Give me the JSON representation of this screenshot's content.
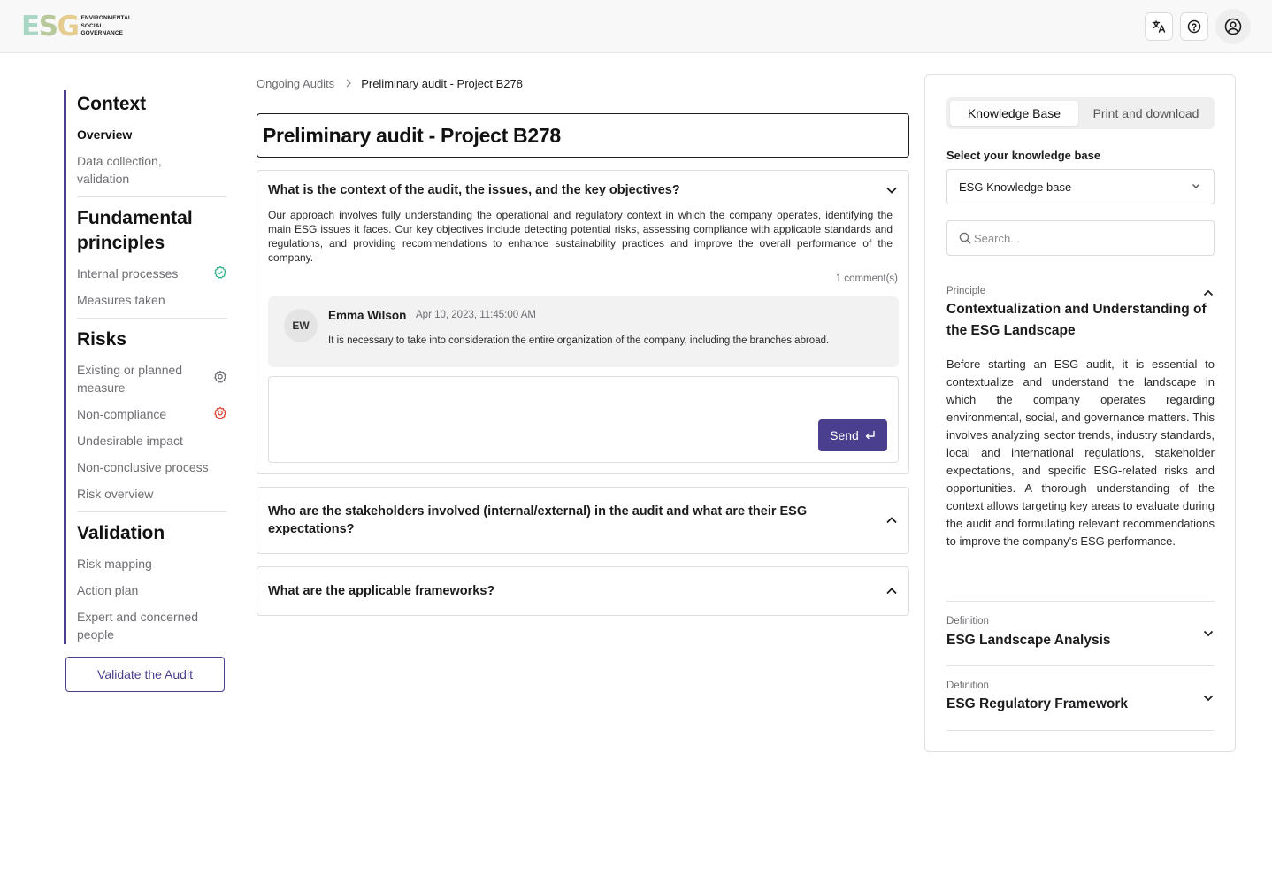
{
  "header": {
    "logo_letters": [
      "E",
      "S",
      "G"
    ],
    "logo_lines": [
      "ENVIRONMENTAL",
      "SOCIAL",
      "GOVERNANCE"
    ],
    "icons": [
      "translate-icon",
      "help-icon",
      "account-icon"
    ]
  },
  "sidebar": {
    "sections": [
      {
        "heading": "Context",
        "items": [
          {
            "label": "Overview",
            "active": true
          },
          {
            "label": "Data collection, validation"
          }
        ]
      },
      {
        "heading": "Fundamental principles",
        "items": [
          {
            "label": "Internal processes",
            "icon": "gear-check-icon",
            "icon_color": "#34b38a"
          },
          {
            "label": "Measures taken"
          }
        ]
      },
      {
        "heading": "Risks",
        "items": [
          {
            "label": "Existing or planned measure",
            "icon": "gear-icon",
            "icon_color": "#6e6e73"
          },
          {
            "label": "Non-compliance",
            "icon": "gear-alert-icon",
            "icon_color": "#e0453a"
          },
          {
            "label": "Undesirable impact"
          },
          {
            "label": "Non-conclusive process"
          },
          {
            "label": "Risk overview"
          }
        ]
      },
      {
        "heading": "Validation",
        "items": [
          {
            "label": "Risk mapping"
          },
          {
            "label": "Action plan"
          },
          {
            "label": "Expert and concerned people"
          }
        ]
      }
    ],
    "validate_label": "Validate the Audit"
  },
  "main": {
    "breadcrumb": {
      "parent": "Ongoing Audits",
      "current": "Preliminary audit - Project B278"
    },
    "title": "Preliminary audit - Project B278",
    "questions": [
      {
        "question": "What is the context of the audit, the issues, and the key objectives?",
        "expanded": true,
        "answer": "Our approach involves fully understanding the operational and regulatory context in which the company operates, identifying the main ESG issues it faces. Our key objectives include detecting potential risks, assessing compliance with applicable standards and regulations, and providing recommendations to enhance sustainability practices and improve the overall performance of the company.",
        "comment_count": "1 comment(s)",
        "comment": {
          "initials": "EW",
          "author": "Emma Wilson",
          "date": "Apr 10, 2023, 11:45:00 AM",
          "text": "It is necessary to take into consideration the entire organization of the company, including the branches abroad."
        },
        "reply_value": "",
        "send_label": "Send"
      },
      {
        "question": "Who are the stakeholders involved (internal/external) in the audit and what are their ESG expectations?",
        "expanded": false
      },
      {
        "question": "What are the applicable frameworks?",
        "expanded": false
      }
    ]
  },
  "knowledge_panel": {
    "tabs": [
      {
        "label": "Knowledge Base",
        "active": true
      },
      {
        "label": "Print and download",
        "active": false
      }
    ],
    "select_label": "Select your knowledge base",
    "selected_kb": "ESG Knowledge base",
    "search_placeholder": "Search...",
    "entries": [
      {
        "kind": "Principle",
        "title": "Contextualization and Understanding of the ESG Landscape",
        "expanded": true,
        "body": "Before starting an ESG audit, it is essential to contextualize and understand the landscape in which the company operates regarding environmental, social, and governance matters. This involves analyzing sector trends, industry standards, local and international regulations, stakeholder expectations, and specific ESG-related risks and opportunities. A thorough understanding of the context allows targeting key areas to evaluate during the audit and formulating relevant recommendations to improve the company's ESG performance."
      },
      {
        "kind": "Definition",
        "title": "ESG Landscape Analysis",
        "expanded": false
      },
      {
        "kind": "Definition",
        "title": "ESG Regulatory Framework",
        "expanded": false
      }
    ]
  },
  "colors": {
    "accent": "#4a3f8e",
    "ok": "#34b38a",
    "alert": "#e0453a",
    "logo": [
      "#a8d5c4",
      "#b7c99b",
      "#e4cd8f"
    ]
  }
}
